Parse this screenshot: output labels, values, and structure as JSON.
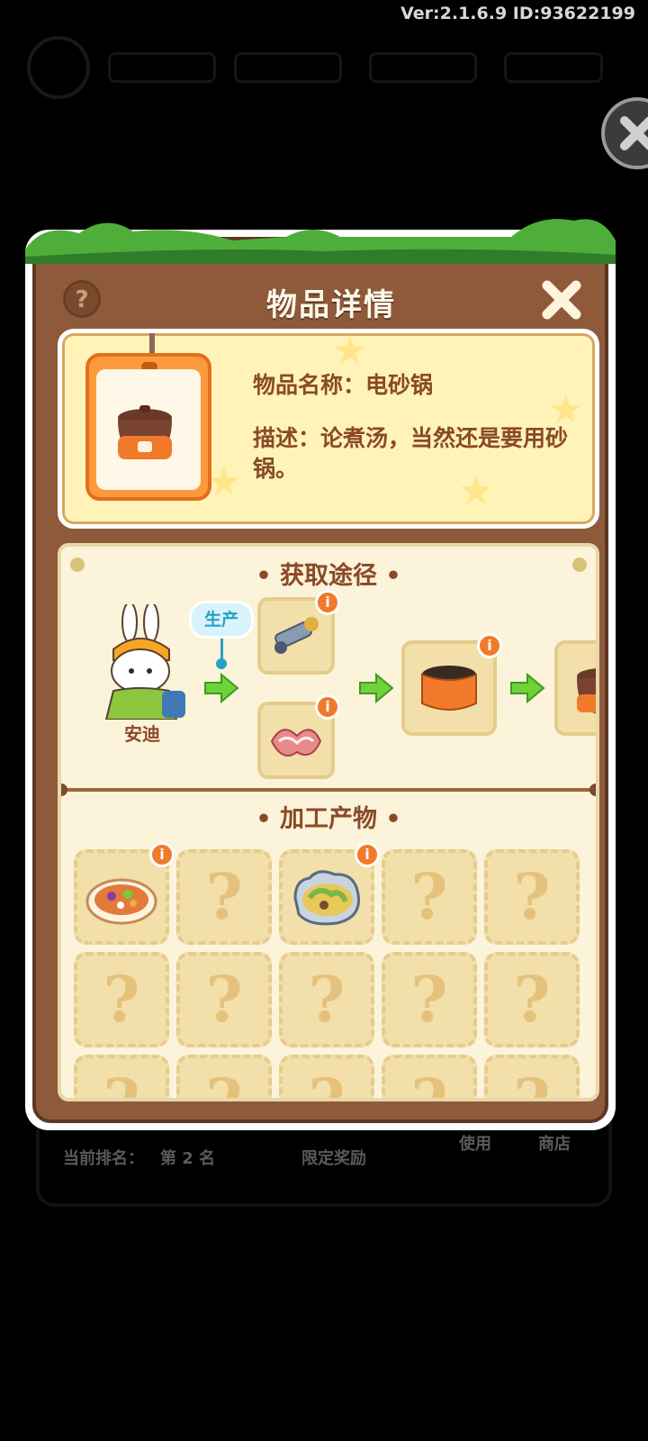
{
  "meta": {
    "version": "Ver:2.1.6.9 ID:93622199"
  },
  "dialog": {
    "title": "物品详情",
    "help_symbol": "?",
    "item": {
      "name_line": "物品名称：电砂锅",
      "description_line": "描述：论煮汤，当然还是要用砂锅。",
      "icon": "electric-clay-pot-icon"
    },
    "acquire": {
      "section_title": "获取途径",
      "character_name": "安迪",
      "produce_label": "生产",
      "ingredients": [
        "machine-parts-icon",
        "bacon-meat-icon"
      ],
      "intermediate": "orange-pot-icon",
      "info_symbol": "i"
    },
    "products": {
      "section_title": "加工产物",
      "unknown_symbol": "?",
      "known": [
        "vegetable-stew-icon",
        "cabbage-soup-icon"
      ]
    }
  },
  "background": {
    "rank_label": "当前排名：",
    "rank_value": "第 2 名",
    "reward_label": "限定奖励",
    "btn_a": "使用",
    "btn_b": "商店"
  },
  "colors": {
    "panel_brown": "#8e5a3b",
    "card_yellow": "#fff3b8",
    "parchment": "#fbf3da",
    "accent_orange": "#f07a2a",
    "produce_blue": "#27a0c4",
    "arrow_green": "#6fd23a"
  }
}
